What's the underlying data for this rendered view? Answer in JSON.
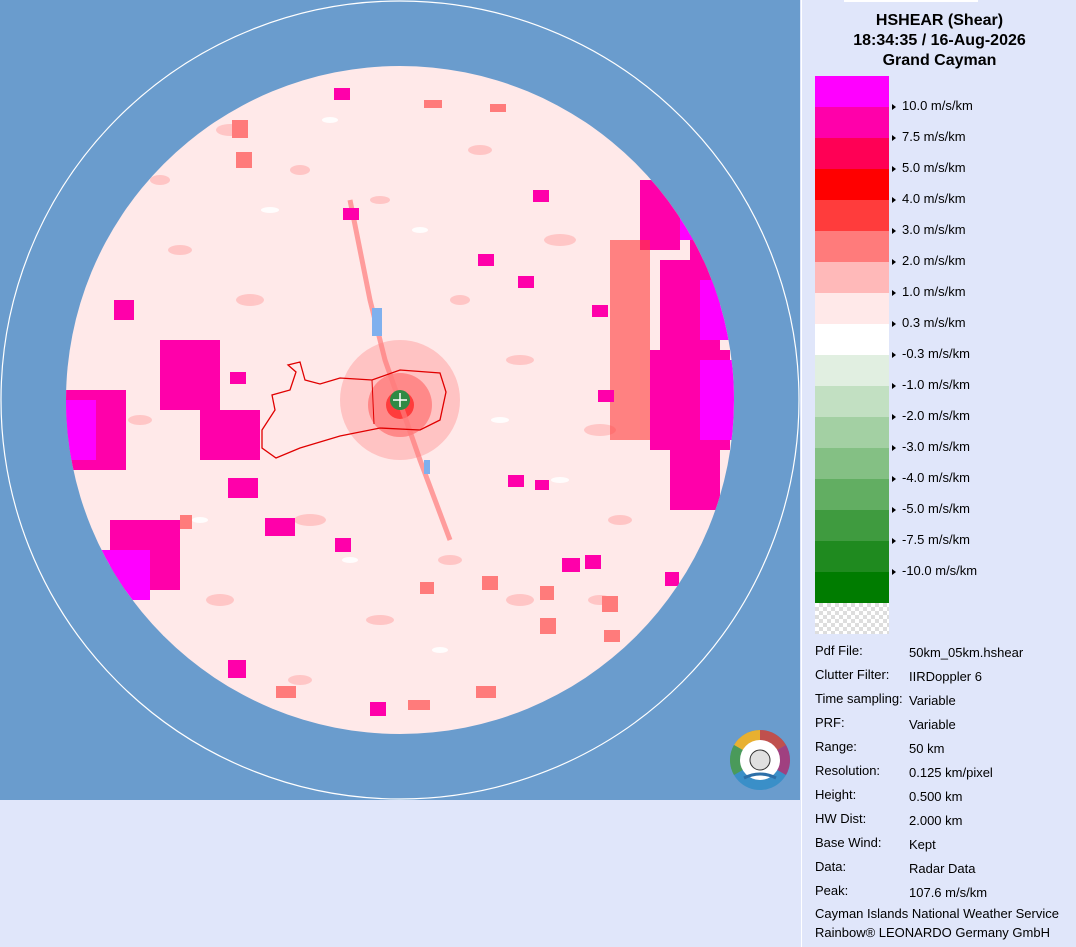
{
  "header": {
    "product": "HSHEAR (Shear)",
    "datetime": "18:34:35 / 16-Aug-2026",
    "site": "Grand Cayman"
  },
  "legend": {
    "unit": "m/s/km",
    "entries": [
      {
        "label": "10.0 m/s/km",
        "color": "#ff00ff"
      },
      {
        "label": "7.5 m/s/km",
        "color": "#ff00aa"
      },
      {
        "label": "5.0 m/s/km",
        "color": "#ff0055"
      },
      {
        "label": "4.0 m/s/km",
        "color": "#ff0000"
      },
      {
        "label": "3.0 m/s/km",
        "color": "#ff3c3c"
      },
      {
        "label": "2.0 m/s/km",
        "color": "#ff7b7b"
      },
      {
        "label": "1.0 m/s/km",
        "color": "#ffb9b9"
      },
      {
        "label": "0.3 m/s/km",
        "color": "#ffe9e9"
      },
      {
        "label": "-0.3 m/s/km",
        "color": "#ffffff"
      },
      {
        "label": "-1.0 m/s/km",
        "color": "#e1efe1"
      },
      {
        "label": "-2.0 m/s/km",
        "color": "#c2e0c2"
      },
      {
        "label": "-3.0 m/s/km",
        "color": "#a3d0a3"
      },
      {
        "label": "-4.0 m/s/km",
        "color": "#84c084"
      },
      {
        "label": "-5.0 m/s/km",
        "color": "#62ae62"
      },
      {
        "label": "-7.5 m/s/km",
        "color": "#3f9b3f"
      },
      {
        "label": "-10.0 m/s/km",
        "color": "#1f8a1f"
      }
    ],
    "extra_colors": [
      "#007c00"
    ]
  },
  "info": [
    {
      "key": "Pdf File:",
      "value": "50km_05km.hshear"
    },
    {
      "key": "Clutter Filter:",
      "value": "IIRDoppler 6"
    },
    {
      "key": "Time sampling:",
      "value": "Variable"
    },
    {
      "key": "PRF:",
      "value": "Variable"
    },
    {
      "key": "Range:",
      "value": "50 km"
    },
    {
      "key": "Resolution:",
      "value": "0.125 km/pixel"
    },
    {
      "key": "Height:",
      "value": "0.500 km"
    },
    {
      "key": "HW Dist:",
      "value": "2.000 km"
    },
    {
      "key": "Base Wind:",
      "value": "Kept"
    },
    {
      "key": "Data:",
      "value": "Radar Data"
    },
    {
      "key": "Peak:",
      "value": "107.6 m/s/km"
    }
  ],
  "credits": {
    "agency": "Cayman Islands National Weather Service",
    "vendor": "Rainbow® LEONARDO Germany GmbH"
  },
  "map": {
    "background_color": "#6a9ccd",
    "disc_color": "#ffe9e9",
    "icons": [
      "radar-site-marker-icon",
      "nws-logo-icon"
    ]
  }
}
